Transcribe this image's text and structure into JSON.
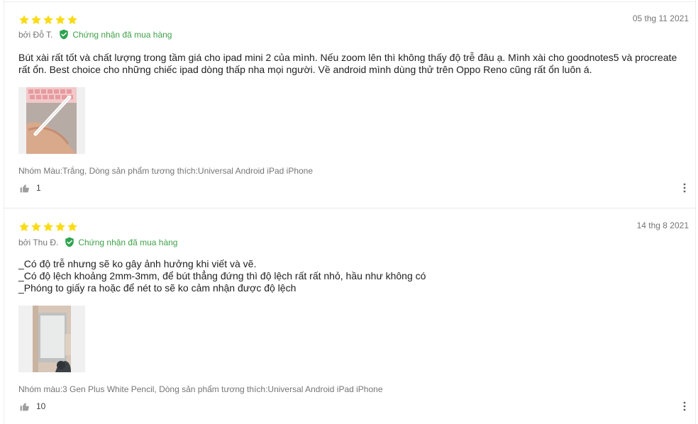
{
  "colors": {
    "star": "#fadb14",
    "verified": "#2ea44f",
    "meta_text": "#757575"
  },
  "reviews": [
    {
      "rating": 5,
      "date": "05 thg 11 2021",
      "author": "bởi Đỗ T.",
      "verified_label": "Chứng nhận đã mua hàng",
      "content": "Bút xài rất tốt và chất lượng trong tầm giá cho ipad mini 2 của mình. Nếu zoom lên thì không thấy độ trễ đâu ạ. Mình xài cho goodnotes5 và procreate rất ổn. Best choice cho những chiếc ipad dòng thấp nha mọi người. Về android mình dùng thử trên Oppo Reno cũng rất ổn luôn á.",
      "sku": "Nhóm Màu:Trắng, Dòng sản phẩm tương thích:Universal Android iPad iPhone",
      "likes": "1"
    },
    {
      "rating": 5,
      "date": "14 thg 8 2021",
      "author": "bởi Thu Đ.",
      "verified_label": "Chứng nhận đã mua hàng",
      "content": "_Có độ trễ nhưng sẽ ko gây ảnh hưởng khi viết và vẽ.\n_Có độ lệch khoảng 2mm-3mm, để bút thẳng đứng thì độ lệch rất rất nhỏ, hầu như không có\n_Phóng to giấy ra hoặc để nét to sẽ ko cảm nhận được độ lệch",
      "sku": "Nhóm màu:3 Gen Plus White Pencil, Dòng sản phẩm tương thích:Universal Android iPad iPhone",
      "likes": "10"
    }
  ]
}
